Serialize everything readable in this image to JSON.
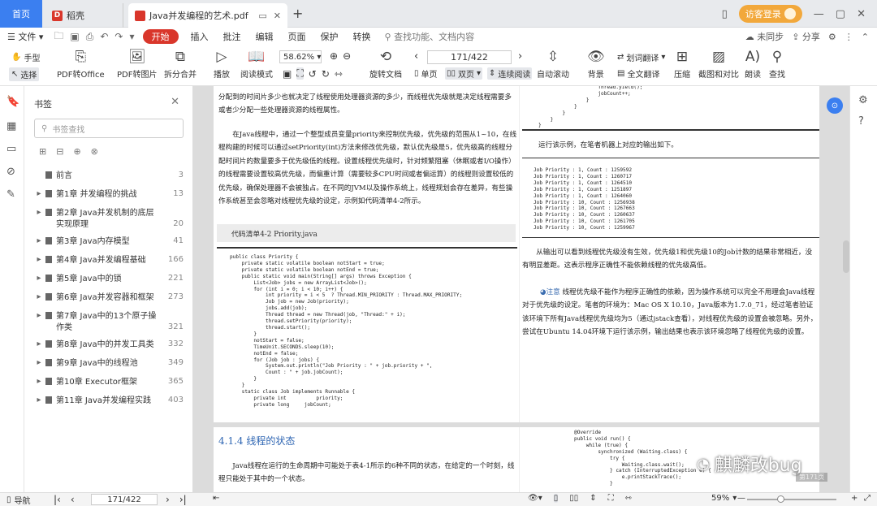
{
  "titlebar": {
    "home_tab": "首页",
    "wps_tab": "稻壳",
    "doc_tab": "Java并发编程的艺术.pdf",
    "login": "访客登录"
  },
  "menubar": {
    "file": "文件",
    "start": "开始",
    "items": [
      "插入",
      "批注",
      "编辑",
      "页面",
      "保护",
      "转换"
    ],
    "search": "查找功能、文档内容",
    "sync": "未同步",
    "share": "分享"
  },
  "toolbar": {
    "hand": "手型",
    "select": "选择",
    "pdf_office": "PDF转Office",
    "pdf_image": "PDF转图片",
    "split_merge": "拆分合并",
    "play": "播放",
    "read_mode": "阅读模式",
    "zoom": "58.62%",
    "rotate": "旋转文档",
    "page_value": "171/422",
    "single": "单页",
    "double": "双页",
    "continuous": "连续阅读",
    "auto_scroll": "自动滚动",
    "background": "背景",
    "word_translate": "划词翻译",
    "full_translate": "全文翻译",
    "compress": "压缩",
    "screenshot": "截图和对比",
    "read_aloud": "朗读",
    "find": "查找"
  },
  "sidebar": {
    "title": "书签",
    "search_placeholder": "书签查找",
    "items": [
      {
        "label": "前言",
        "page": "3",
        "expand": false
      },
      {
        "label": "第1章 并发编程的挑战",
        "page": "13",
        "expand": true
      },
      {
        "label": "第2章 Java并发机制的底层实现原理",
        "page": "20",
        "expand": true
      },
      {
        "label": "第3章 Java内存模型",
        "page": "41",
        "expand": true
      },
      {
        "label": "第4章 Java并发编程基础",
        "page": "166",
        "expand": true
      },
      {
        "label": "第5章 Java中的锁",
        "page": "221",
        "expand": true
      },
      {
        "label": "第6章 Java并发容器和框架",
        "page": "273",
        "expand": true
      },
      {
        "label": "第7章 Java中的13个原子操作类",
        "page": "321",
        "expand": true
      },
      {
        "label": "第8章 Java中的并发工具类",
        "page": "332",
        "expand": true
      },
      {
        "label": "第9章 Java中的线程池",
        "page": "349",
        "expand": true
      },
      {
        "label": "第10章 Executor框架",
        "page": "365",
        "expand": true
      },
      {
        "label": "第11章 Java并发编程实践",
        "page": "403",
        "expand": true
      }
    ]
  },
  "doc": {
    "p_intro": "分配到的时间片多少也就决定了线程使用处理器资源的多少，而线程优先级就是决定线程需要多或者少分配一些处理器资源的线程属性。",
    "p_priority": "在Java线程中，通过一个整型成员变量priority来控制优先级，优先级的范围从1~10，在线程构建的时候可以通过setPriority(int)方法来修改优先级，默认优先级是5，优先级高的线程分配时间片的数量要多于优先级低的线程。设置线程优先级时，针对频繁阻塞（休眠或者I/O操作）的线程需要设置较高优先级，而偏重计算（需要较多CPU时间或者偏运算）的线程则设置较低的优先级，确保处理器不会被独占。在不同的JVM以及操作系统上，线程规划会存在差异，有些操作系统甚至会忽略对线程优先级的设定，示例如代码清单4-2所示。",
    "listing_title": "代码清单4-2  Priority.java",
    "code_left": "public class Priority {\n    private static volatile boolean notStart = true;\n    private static volatile boolean notEnd = true;\n    public static void main(String[] args) throws Exception {\n        List<Job> jobs = new ArrayList<Job>();\n        for (int i = 0; i < 10; i++) {\n            int priority = i < 5  ? Thread.MIN_PRIORITY : Thread.MAX_PRIORITY;\n            Job job = new Job(priority);\n            jobs.add(job);\n            Thread thread = new Thread(job, \"Thread:\" + i);\n            thread.setPriority(priority);\n            thread.start();\n        }\n        notStart = false;\n        TimeUnit.SECONDS.sleep(10);\n        notEnd = false;\n        for (Job job : jobs) {\n            System.out.println(\"Job Priority : \" + job.priority + \",\n            Count : \" + job.jobCount);\n        }\n    }\n    static class Job implements Runnable {\n        private int          priority;\n        private long     jobCount;",
    "code_right_top": "                    Thread.yield();\n                    jobCount++;\n                }\n            }\n        }\n    }\n}",
    "run_text": "运行该示例，在笔者机器上对应的输出如下。",
    "output": "Job Priority : 1, Count : 1259592\nJob Priority : 1, Count : 1260717\nJob Priority : 1, Count : 1264510\nJob Priority : 1, Count : 1251897\nJob Priority : 1, Count : 1264060\nJob Priority : 10, Count : 1256938\nJob Priority : 10, Count : 1267663\nJob Priority : 10, Count : 1260637\nJob Priority : 10, Count : 1261705\nJob Priority : 10, Count : 1259967",
    "p_conclusion": "从输出可以看到线程优先级没有生效，优先级1和优先级10的Job计数的结果非常相近，没有明显差距。这表示程序正确性不能依赖线程的优先级高低。",
    "note_label": "注意",
    "p_note": "线程优先级不能作为程序正确性的依赖，因为操作系统可以完全不用理会Java线程对于优先级的设定。笔者的环境为：Mac OS X 10.10，Java版本为1.7.0_71，经过笔者验证该环境下所有Java线程优先级均为5（通过jstack查看），对线程优先级的设置会被忽略。另外，尝试在Ubuntu 14.04环境下运行该示例，输出结果也表示该环境忽略了线程优先级的设置。",
    "section_title": "4.1.4  线程的状态",
    "p_state": "Java线程在运行的生命周期中可能处于表4-1所示的6种不同的状态，在给定的一个时刻，线程只能处于其中的一个状态。",
    "code_page2": "            @Override\n            public void run() {\n                while (true) {\n                    synchronized (Waiting.class) {\n                        try {\n                            Waiting.class.wait();\n                        } catch (InterruptedException e) {\n                            e.printStackTrace();\n                        }"
  },
  "status": {
    "nav": "导航",
    "page_value": "171/422",
    "zoom": "59%"
  },
  "watermark": {
    "text": "麒麟改bug",
    "badge": "第171页"
  }
}
